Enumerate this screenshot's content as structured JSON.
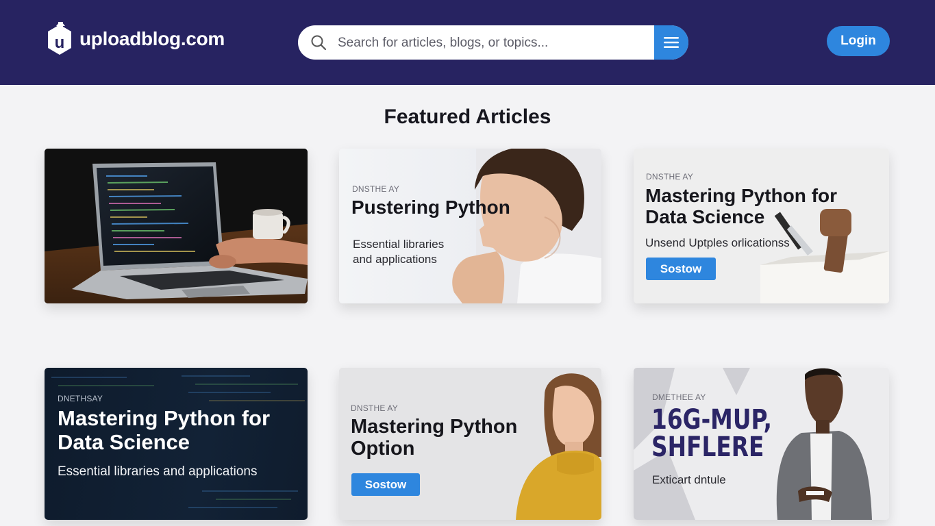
{
  "brand": {
    "name": "uploadblog.com",
    "logo_letter": "u"
  },
  "search": {
    "placeholder": "Search for articles, blogs, or topics..."
  },
  "header": {
    "login_label": "Login"
  },
  "featured": {
    "title": "Featured Articles",
    "cards": [
      {
        "image": "laptop-coding-photo"
      },
      {
        "kicker": "DNSTHE AY",
        "title": "Pustering Python",
        "subtitle_lines": [
          "Essential libraries",
          "and applications"
        ],
        "image": "thinking-man-photo"
      },
      {
        "kicker": "DNSTHE AY",
        "title_lines": [
          "Mastering Python for",
          "Data Science"
        ],
        "subtitle": "Unsend Uptples orlicationss",
        "button": "Sostow",
        "image": "tools-in-box-photo"
      },
      {
        "kicker": "DNETHSAY",
        "title_lines": [
          "Mastering Python for",
          "Data Science"
        ],
        "subtitle": "Essential libraries and applications",
        "image": "code-screen-background"
      },
      {
        "kicker": "DNSTHE AY",
        "title_lines": [
          "Mastering Python",
          "Option"
        ],
        "button": "Sostow",
        "image": "woman-yellow-sweater-photo"
      },
      {
        "kicker": "DMETHEE AY",
        "title_lines": [
          "16G-MUP,",
          "SHFLERE"
        ],
        "subtitle": "Exticart dntule",
        "image": "man-gray-jacket-photo"
      }
    ]
  },
  "colors": {
    "header_bg": "#272361",
    "accent": "#2e86de",
    "page_bg": "#f3f3f5",
    "headline_purple": "#2b2566"
  }
}
